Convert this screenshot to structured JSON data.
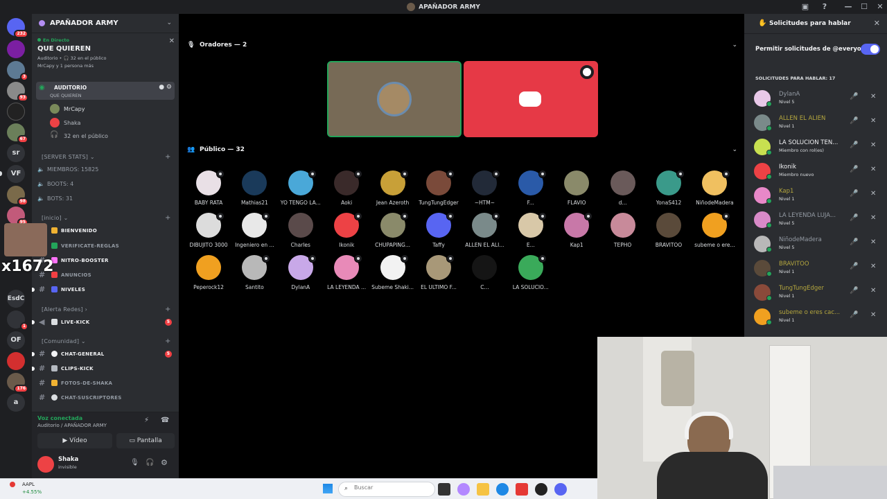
{
  "window": {
    "title": "APAÑADOR ARMY"
  },
  "rail": {
    "servers": [
      {
        "badge": "232"
      },
      {
        "badge": ""
      },
      {
        "badge": "3"
      },
      {
        "badge": "93"
      },
      {
        "badge": ""
      },
      {
        "badge": "67"
      },
      {
        "label": "sr"
      },
      {
        "label": "VF"
      },
      {
        "badge": "98"
      },
      {
        "badge": "95"
      },
      {
        "badge": ""
      },
      {
        "label": "x1672"
      },
      {
        "label": "EsdC"
      },
      {
        "badge": "1"
      },
      {
        "label": "OF"
      },
      {
        "badge": ""
      },
      {
        "badge": "176"
      },
      {
        "label": "a"
      }
    ]
  },
  "sidebar": {
    "server_name": "APAÑADOR ARMY",
    "live": {
      "tag": "En Directo",
      "title": "QUE QUIEREN",
      "line1": "Auditorio • 🎧 32 en el público",
      "line2": "MrCapy y 1 persona más"
    },
    "active_channel": {
      "label": "Auditorio",
      "sub": "QUE QUIEREN"
    },
    "stage_members": [
      {
        "name": "MrCapy"
      },
      {
        "name": "Shaka"
      },
      {
        "name": "32 en el público"
      }
    ],
    "categories": {
      "stats": "[SERVER STATS]",
      "inicio": "[inicio]",
      "alerta": "[Alerta Redes]",
      "comunidad": "[Comunidad]"
    },
    "stats": [
      "MIEMBROS: 15825",
      "BOOTS: 4",
      "BOTS: 31"
    ],
    "channels_inicio": [
      "bienvenido",
      "verificate-reglas",
      "nitro-booster",
      "anuncios",
      "niveles"
    ],
    "channels_alerta": [
      {
        "label": "live-kick",
        "count": "5"
      }
    ],
    "channels_comunidad": [
      {
        "label": "chat-general",
        "count": "5"
      },
      {
        "label": "clips-kick"
      },
      {
        "label": "fotos-de-shaka"
      },
      {
        "label": "chat-suscriptores"
      }
    ],
    "voice": {
      "status": "Voz conectada",
      "channel": "Auditorio / APAÑADOR ARMY",
      "video": "Vídeo",
      "screen": "Pantalla"
    },
    "user": {
      "name": "Shaka",
      "status": "invisible"
    }
  },
  "stage": {
    "speakers_header": "Oradores — 2",
    "audience_header": "Público — 32",
    "audience": [
      "BABY RATA",
      "Mathias21",
      "YO TENGO LA...",
      "Aoki",
      "Jean Azeroth",
      "TungTungEdger",
      "~HTM~",
      "F...",
      "FLAVIO",
      "d...",
      "YonaS412",
      "NiñodeMadera",
      "DIBUJITO 3000",
      "Ingeniero en ...",
      "Charles",
      "Ikonik",
      "CHUPAPING...",
      "Taffy",
      "ALLEN EL ALI...",
      "E...",
      "Kap1",
      "TEPHO",
      "BRAVITOO",
      "subeme o ere...",
      "Peperock12",
      "Santito",
      "DylanA",
      "LA LEYENDA ...",
      "Subeme Shaki...",
      "EL ULTIMO F...",
      "C...",
      "LA SOLUCIO..."
    ]
  },
  "panel": {
    "title": "Solicitudes para hablar",
    "toggle_label": "Permitir solicitudes de @everyone",
    "list_header": "SOLICITUDES PARA HABLAR: 17",
    "requests": [
      {
        "name": "DylanA",
        "level": "Nivel 5",
        "color": "#949ba4"
      },
      {
        "name": "ALLEN EL ALIEN",
        "level": "Nivel 1",
        "color": "#b5a73e"
      },
      {
        "name": "LA SOLUCION TEN...",
        "level": "Miembro con rol(es)",
        "color": "#f2f3f5"
      },
      {
        "name": "Ikonik",
        "level": "Miembro nuevo",
        "color": "#f2f3f5"
      },
      {
        "name": "Kap1",
        "level": "Nivel 1",
        "color": "#b5a73e"
      },
      {
        "name": "LA LEYENDA LUJA...",
        "level": "Nivel 5",
        "color": "#949ba4"
      },
      {
        "name": "NiñodeMadera",
        "level": "Nivel 5",
        "color": "#949ba4"
      },
      {
        "name": "BRAVITOO",
        "level": "Nivel 1",
        "color": "#b5a73e"
      },
      {
        "name": "TungTungEdger",
        "level": "Nivel 1",
        "color": "#b5a73e"
      },
      {
        "name": "subeme o eres cac...",
        "level": "Nivel 1",
        "color": "#b5a73e"
      }
    ]
  },
  "taskbar": {
    "ticker": "AAPL",
    "change": "+4.55%",
    "search_placeholder": "Buscar"
  }
}
